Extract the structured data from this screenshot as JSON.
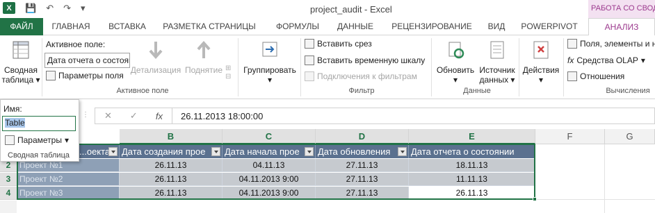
{
  "window": {
    "title": "project_audit - Excel",
    "context_title": "РАБОТА СО СВОДНЫМИ"
  },
  "tabs": [
    "ФАЙЛ",
    "ГЛАВНАЯ",
    "ВСТАВКА",
    "РАЗМЕТКА СТРАНИЦЫ",
    "ФОРМУЛЫ",
    "ДАННЫЕ",
    "РЕЦЕНЗИРОВАНИЕ",
    "ВИД",
    "POWERPIVOT",
    "АНАЛИЗ"
  ],
  "ribbon": {
    "pivot": {
      "label_1": "Сводная",
      "label_2": "таблица"
    },
    "active_field": {
      "label": "Активное поле:",
      "value": "Дата отчета о состоянии",
      "params": "Параметры поля",
      "drill_down": "Детализация",
      "drill_up": "Поднятие",
      "group_label": "Активное поле"
    },
    "group_btn": "Группировать",
    "filter": {
      "slicer": "Вставить срез",
      "timeline": "Вставить временную шкалу",
      "connections": "Подключения к фильтрам",
      "group_label": "Фильтр"
    },
    "data": {
      "refresh": "Обновить",
      "source_1": "Источник",
      "source_2": "данных",
      "group_label": "Данные"
    },
    "actions": "Действия",
    "calc": {
      "fields": "Поля, элементы и н",
      "olap": "Средства OLAP",
      "relations": "Отношения",
      "group_label": "Вычисления"
    }
  },
  "name_box": {
    "label": "Имя:",
    "value": "Table",
    "params": "Параметры",
    "footer": "Сводная таблица"
  },
  "formula": {
    "value": "26.11.2013  18:00:00"
  },
  "columns": [
    "B",
    "C",
    "D",
    "E",
    "F",
    "G"
  ],
  "table": {
    "headers": [
      "...оекта",
      "Дата создания прое",
      "Дата начала прое",
      "Дата обновления",
      "Дата отчета о состоянии"
    ],
    "rows": [
      {
        "num": "2",
        "cells": [
          "Проект №1",
          "26.11.13",
          "04.11.13",
          "27.11.13",
          "18.11.13"
        ]
      },
      {
        "num": "3",
        "cells": [
          "Проект №2",
          "26.11.13",
          "04.11.2013 9:00",
          "27.11.13",
          "11.11.13"
        ]
      },
      {
        "num": "4",
        "cells": [
          "Проект №3",
          "26.11.13",
          "04.11.2013 9:00",
          "27.11.13",
          "26.11.13"
        ]
      }
    ]
  }
}
